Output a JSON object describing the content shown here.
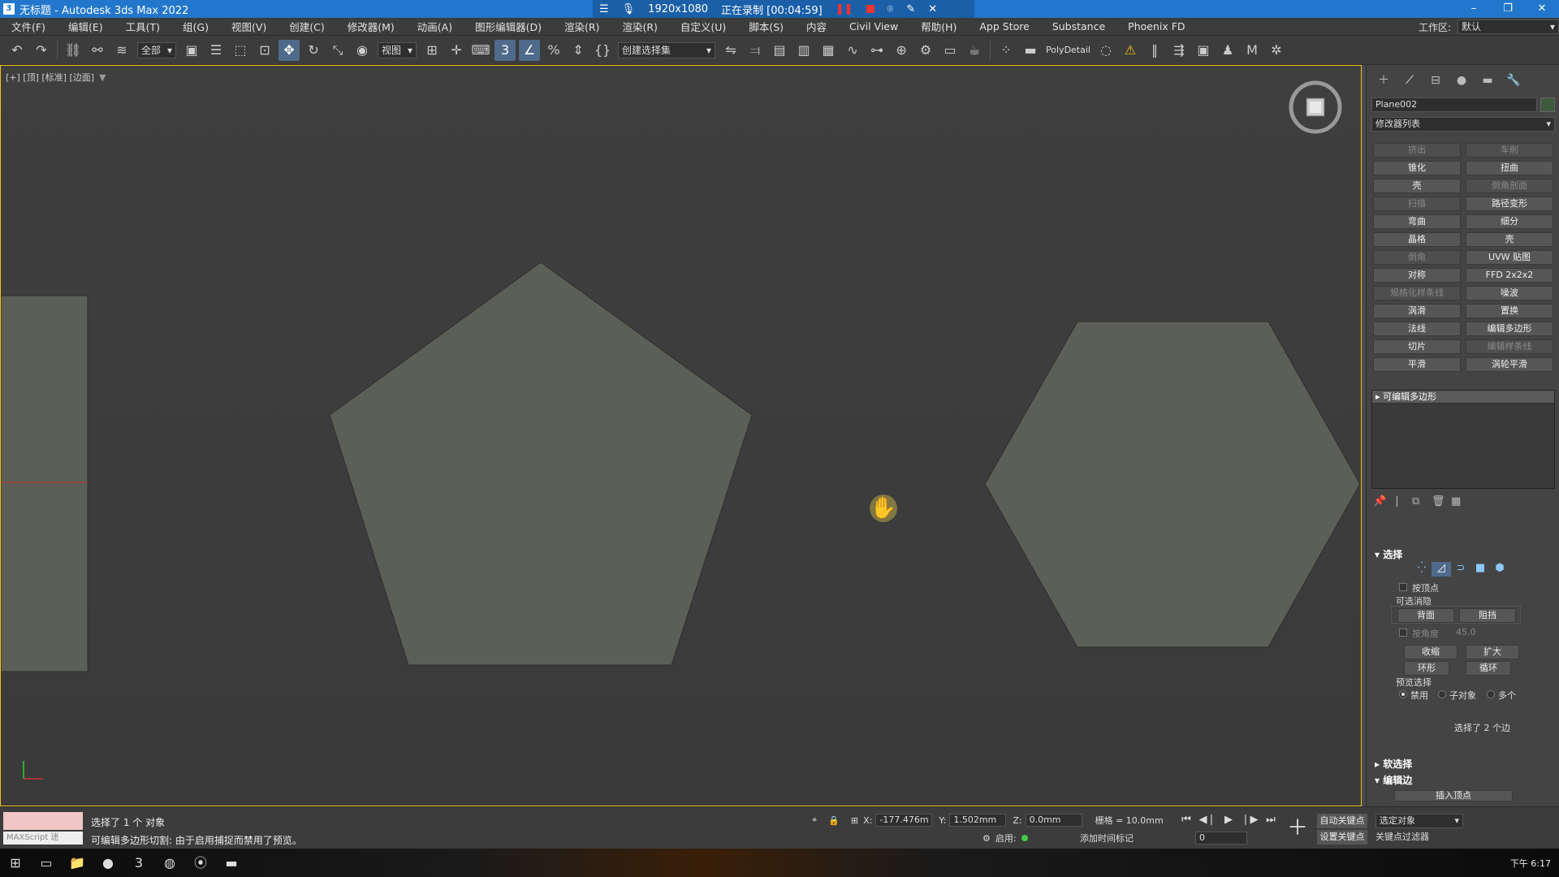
{
  "window": {
    "title": "无标题 - Autodesk 3ds Max 2022",
    "recording": {
      "resolution": "1920x1080",
      "status": "正在录制 [00:04:59]"
    },
    "controls": [
      "–",
      "❐",
      "✕"
    ]
  },
  "menu": {
    "items": [
      "文件(F)",
      "编辑(E)",
      "工具(T)",
      "组(G)",
      "视图(V)",
      "创建(C)",
      "修改器(M)",
      "动画(A)",
      "图形编辑器(D)",
      "渲染(R)",
      "渲染(R)",
      "自定义(U)",
      "脚本(S)",
      "内容",
      "Civil View",
      "帮助(H)",
      "App Store",
      "Substance",
      "Phoenix FD"
    ],
    "workspace_label": "工作区:",
    "workspace_value": "默认"
  },
  "toolbar": {
    "selection_filter": "全部",
    "ref_coord": "视图",
    "named_selection": "创建选择集",
    "polydetail": "PolyDetail"
  },
  "viewport": {
    "label": "[+] [顶] [标准] [边面]",
    "colors": {
      "shape_fill": "#5b5f57",
      "shape_stroke": "#2c2f2a",
      "axis_red": "#c03030"
    }
  },
  "command_panel": {
    "object_name": "Plane002",
    "modifier_list": "修改器列表",
    "modifiers": [
      {
        "label": "挤出",
        "enabled": false
      },
      {
        "label": "车削",
        "enabled": false
      },
      {
        "label": "锥化",
        "enabled": true
      },
      {
        "label": "扭曲",
        "enabled": true
      },
      {
        "label": "壳",
        "enabled": true
      },
      {
        "label": "倒角剖面",
        "enabled": false
      },
      {
        "label": "扫描",
        "enabled": false
      },
      {
        "label": "路径变形",
        "enabled": true
      },
      {
        "label": "弯曲",
        "enabled": true
      },
      {
        "label": "细分",
        "enabled": true
      },
      {
        "label": "晶格",
        "enabled": true
      },
      {
        "label": "壳",
        "enabled": true
      },
      {
        "label": "倒角",
        "enabled": false
      },
      {
        "label": "UVW 贴图",
        "enabled": true
      },
      {
        "label": "对称",
        "enabled": true
      },
      {
        "label": "FFD 2x2x2",
        "enabled": true
      },
      {
        "label": "规格化样条线",
        "enabled": false
      },
      {
        "label": "噪波",
        "enabled": true
      },
      {
        "label": "涡滑",
        "enabled": true
      },
      {
        "label": "置换",
        "enabled": true
      },
      {
        "label": "法线",
        "enabled": true
      },
      {
        "label": "编辑多边形",
        "enabled": true
      },
      {
        "label": "切片",
        "enabled": true
      },
      {
        "label": "编辑样条线",
        "enabled": false
      },
      {
        "label": "平滑",
        "enabled": true
      },
      {
        "label": "涡轮平滑",
        "enabled": true
      }
    ],
    "stack_item": "可编辑多边形",
    "rollouts": {
      "selection": "选择",
      "by_vertex": "按顶点",
      "ignore_back": "可选消隐",
      "back_face": "背面",
      "occlude": "阻挡",
      "by_angle": "按角度",
      "angle_value": "45.0",
      "shrink": "收缩",
      "grow": "扩大",
      "ring": "环形",
      "loop": "循环",
      "preview": "预览选择",
      "preview_off": "禁用",
      "preview_sub": "子对象",
      "preview_multi": "多个",
      "selected_count": "选择了 2 个边",
      "soft_selection": "软选择",
      "edit_edges": "编辑边",
      "insert_vertex": "插入顶点"
    }
  },
  "status": {
    "maxscript_label": "MAXScript 迷",
    "selection": "选择了 1 个 对象",
    "prompt": "可编辑多边形切割: 由于启用捕捉而禁用了预览。",
    "x_label": "X:",
    "x": "-177.476m",
    "y_label": "Y:",
    "y": "1.502mm",
    "z_label": "Z:",
    "z": "0.0mm",
    "grid": "栅格 = 10.0mm",
    "enable": "启用:",
    "time_tag": "添加时间标记",
    "auto_key": "自动关键点",
    "set_key": "设置关键点",
    "selected_object": "选定对象",
    "key_filter": "关键点过滤器",
    "frame": "0"
  },
  "taskbar": {
    "clock": "下午 6:17"
  }
}
